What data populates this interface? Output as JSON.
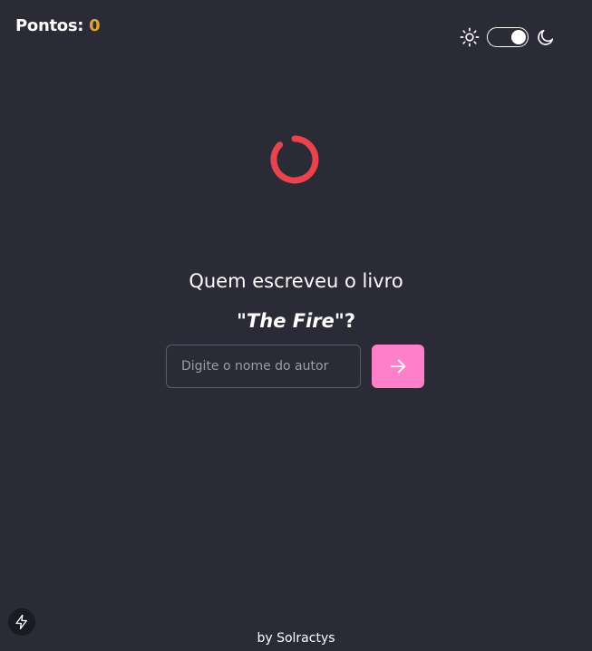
{
  "score": {
    "label": "Pontos:",
    "value": "0"
  },
  "theme": {
    "sun_icon": "sun-icon",
    "moon_icon": "moon-icon",
    "mode": "dark"
  },
  "loading": {
    "icon": "spinner-icon",
    "color": "#e9434d"
  },
  "question": {
    "prompt": "Quem escreveu o livro",
    "quote_open": "\"",
    "book_title": "The Fire",
    "quote_close": "\"?"
  },
  "answer": {
    "placeholder": "Digite o nome do autor",
    "value": "",
    "submit_icon": "arrow-right-icon",
    "submit_color": "#ff7fc8"
  },
  "floating": {
    "icon": "bolt-icon"
  },
  "footer": {
    "credit": "by Solractys"
  },
  "colors": {
    "background": "#2a2b37",
    "score_value": "#e0a32e"
  }
}
